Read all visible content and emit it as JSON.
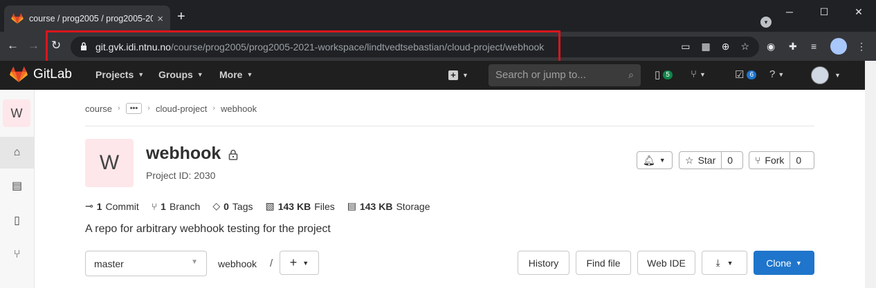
{
  "browser": {
    "tab_title": "course / prog2005 / prog2005-20",
    "tab_close": "×",
    "new_tab": "+",
    "url_host": "git.gvk.idi.ntnu.no",
    "url_path": "/course/prog2005/prog2005-2021-workspace/lindtvedtsebastian/cloud-project/webhook",
    "minimize": "─",
    "maximize": "☐",
    "close": "✕"
  },
  "gitlab_nav": {
    "brand": "GitLab",
    "menus": [
      "Projects",
      "Groups",
      "More"
    ],
    "search_placeholder": "Search or jump to...",
    "issues_count": "5",
    "todos_count": "6"
  },
  "sidebar": {
    "project_letter": "W"
  },
  "breadcrumb": {
    "root": "course",
    "ellipsis": "•••",
    "parent": "cloud-project",
    "current": "webhook"
  },
  "project": {
    "avatar_letter": "W",
    "name": "webhook",
    "id_label": "Project ID: 2030",
    "star_label": "Star",
    "star_count": "0",
    "fork_label": "Fork",
    "fork_count": "0",
    "description": "A repo for arbitrary webhook testing for the project"
  },
  "stats": {
    "commits_count": "1",
    "commits_label": "Commit",
    "branches_count": "1",
    "branches_label": "Branch",
    "tags_count": "0",
    "tags_label": "Tags",
    "files_size": "143 KB",
    "files_label": "Files",
    "storage_size": "143 KB",
    "storage_label": "Storage"
  },
  "repo_toolbar": {
    "branch": "master",
    "path": "webhook",
    "path_sep": "/",
    "history": "History",
    "find_file": "Find file",
    "web_ide": "Web IDE",
    "clone": "Clone"
  },
  "colors": {
    "accent": "#1f75cb",
    "highlight_box": "#d9161d",
    "project_avatar_bg": "#fde7ea"
  }
}
